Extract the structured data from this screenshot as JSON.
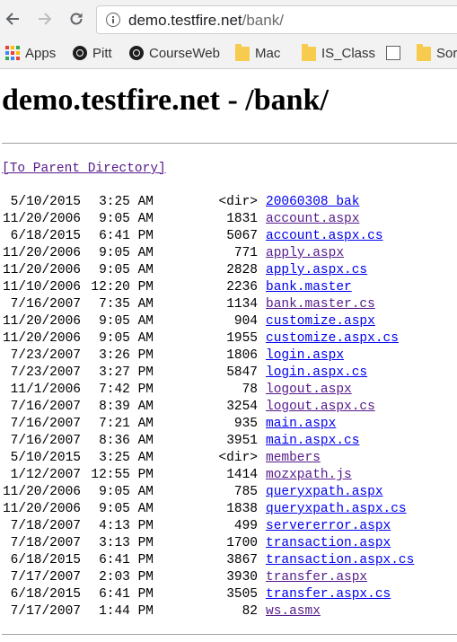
{
  "browser": {
    "url_host": "demo.testfire.net",
    "url_path": "/bank/",
    "bookmarks": [
      {
        "label": "Apps",
        "icon": "apps-icon"
      },
      {
        "label": "Pitt",
        "icon": "pitt-icon"
      },
      {
        "label": "CourseWeb",
        "icon": "courseweb-icon"
      },
      {
        "label": "Mac",
        "icon": "folder-icon"
      },
      {
        "label": "IS_Class",
        "icon": "folder-icon"
      },
      {
        "label": "",
        "icon": "page-icon"
      },
      {
        "label": "Sor",
        "icon": "folder-icon"
      }
    ]
  },
  "page": {
    "title": "demo.testfire.net - /bank/",
    "parent_link": "[To Parent Directory]",
    "entries": [
      {
        "date": "5/10/2015",
        "time": "3:25 AM",
        "size": "<dir>",
        "name": "20060308_bak"
      },
      {
        "date": "11/20/2006",
        "time": "9:05 AM",
        "size": "1831",
        "name": "account.aspx"
      },
      {
        "date": "6/18/2015",
        "time": "6:41 PM",
        "size": "5067",
        "name": "account.aspx.cs"
      },
      {
        "date": "11/20/2006",
        "time": "9:05 AM",
        "size": "771",
        "name": "apply.aspx"
      },
      {
        "date": "11/20/2006",
        "time": "9:05 AM",
        "size": "2828",
        "name": "apply.aspx.cs"
      },
      {
        "date": "11/10/2006",
        "time": "12:20 PM",
        "size": "2236",
        "name": "bank.master"
      },
      {
        "date": "7/16/2007",
        "time": "7:35 AM",
        "size": "1134",
        "name": "bank.master.cs"
      },
      {
        "date": "11/20/2006",
        "time": "9:05 AM",
        "size": "904",
        "name": "customize.aspx"
      },
      {
        "date": "11/20/2006",
        "time": "9:05 AM",
        "size": "1955",
        "name": "customize.aspx.cs"
      },
      {
        "date": "7/23/2007",
        "time": "3:26 PM",
        "size": "1806",
        "name": "login.aspx"
      },
      {
        "date": "7/23/2007",
        "time": "3:27 PM",
        "size": "5847",
        "name": "login.aspx.cs"
      },
      {
        "date": "11/1/2006",
        "time": "7:42 PM",
        "size": "78",
        "name": "logout.aspx"
      },
      {
        "date": "7/16/2007",
        "time": "8:39 AM",
        "size": "3254",
        "name": "logout.aspx.cs"
      },
      {
        "date": "7/16/2007",
        "time": "7:21 AM",
        "size": "935",
        "name": "main.aspx"
      },
      {
        "date": "7/16/2007",
        "time": "8:36 AM",
        "size": "3951",
        "name": "main.aspx.cs"
      },
      {
        "date": "5/10/2015",
        "time": "3:25 AM",
        "size": "<dir>",
        "name": "members"
      },
      {
        "date": "1/12/2007",
        "time": "12:55 PM",
        "size": "1414",
        "name": "mozxpath.js"
      },
      {
        "date": "11/20/2006",
        "time": "9:05 AM",
        "size": "785",
        "name": "queryxpath.aspx"
      },
      {
        "date": "11/20/2006",
        "time": "9:05 AM",
        "size": "1838",
        "name": "queryxpath.aspx.cs"
      },
      {
        "date": "7/18/2007",
        "time": "4:13 PM",
        "size": "499",
        "name": "servererror.aspx"
      },
      {
        "date": "7/18/2007",
        "time": "3:13 PM",
        "size": "1700",
        "name": "transaction.aspx"
      },
      {
        "date": "6/18/2015",
        "time": "6:41 PM",
        "size": "3867",
        "name": "transaction.aspx.cs"
      },
      {
        "date": "7/17/2007",
        "time": "2:03 PM",
        "size": "3930",
        "name": "transfer.aspx"
      },
      {
        "date": "6/18/2015",
        "time": "6:41 PM",
        "size": "3505",
        "name": "transfer.aspx.cs"
      },
      {
        "date": "7/17/2007",
        "time": "1:44 PM",
        "size": "82",
        "name": "ws.asmx"
      }
    ]
  },
  "colors": {
    "link": "#0000ee",
    "visited_link": "#551a8b"
  }
}
